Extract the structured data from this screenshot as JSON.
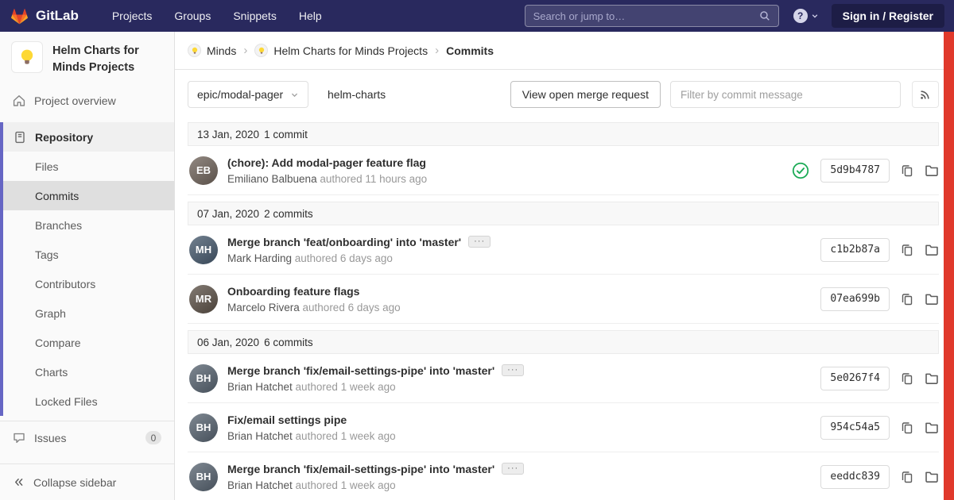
{
  "navbar": {
    "brand": "GitLab",
    "menu": [
      "Projects",
      "Groups",
      "Snippets",
      "Help"
    ],
    "search_placeholder": "Search or jump to…",
    "sign_in_label": "Sign in / Register"
  },
  "sidebar": {
    "project_title": "Helm Charts for Minds Projects",
    "overview_label": "Project overview",
    "repository_label": "Repository",
    "repo_items": [
      "Files",
      "Commits",
      "Branches",
      "Tags",
      "Contributors",
      "Graph",
      "Compare",
      "Charts",
      "Locked Files"
    ],
    "active_repo_item": "Commits",
    "issues_label": "Issues",
    "issues_count": "0",
    "collapse_label": "Collapse sidebar"
  },
  "breadcrumb": {
    "items": [
      {
        "label": "Minds",
        "avatar": true
      },
      {
        "label": "Helm Charts for Minds Projects",
        "avatar": true
      },
      {
        "label": "Commits",
        "avatar": false
      }
    ],
    "separator": "›"
  },
  "controls": {
    "branch": "epic/modal-pager",
    "repo_name": "helm-charts",
    "view_mr_label": "View open merge request",
    "filter_placeholder": "Filter by commit message"
  },
  "icons": {
    "ellipsis": "···"
  },
  "colors": {
    "navbar": "#29295e",
    "sidebar_accent": "#6666c4",
    "success_green": "#1aaa55",
    "scrollbar_red": "#e0392b",
    "logo_red": "#e24329",
    "logo_orange": "#fc6d26",
    "logo_yellow": "#fca326"
  },
  "commits": {
    "groups": [
      {
        "date": "13 Jan, 2020",
        "count": "1 commit",
        "items": [
          {
            "title": "(chore): Add modal-pager feature flag",
            "author": "Emiliano Balbuena",
            "time": "authored 11 hours ago",
            "sha": "5d9b4787",
            "pipeline_passed": true,
            "expandable": false,
            "initials": "EB",
            "avatar_color": "#6e6259"
          }
        ]
      },
      {
        "date": "07 Jan, 2020",
        "count": "2 commits",
        "items": [
          {
            "title": "Merge branch 'feat/onboarding' into 'master'",
            "author": "Mark Harding",
            "time": "authored 6 days ago",
            "sha": "c1b2b87a",
            "pipeline_passed": false,
            "expandable": true,
            "initials": "MH",
            "avatar_color": "#44576b"
          },
          {
            "title": "Onboarding feature flags",
            "author": "Marcelo Rivera",
            "time": "authored 6 days ago",
            "sha": "07ea699b",
            "pipeline_passed": false,
            "expandable": false,
            "initials": "MR",
            "avatar_color": "#5a4f45"
          }
        ]
      },
      {
        "date": "06 Jan, 2020",
        "count": "6 commits",
        "items": [
          {
            "title": "Merge branch 'fix/email-settings-pipe' into 'master'",
            "author": "Brian Hatchet",
            "time": "authored 1 week ago",
            "sha": "5e0267f4",
            "pipeline_passed": false,
            "expandable": true,
            "initials": "BH",
            "avatar_color": "#55616e"
          },
          {
            "title": "Fix/email settings pipe",
            "author": "Brian Hatchet",
            "time": "authored 1 week ago",
            "sha": "954c54a5",
            "pipeline_passed": false,
            "expandable": false,
            "initials": "BH",
            "avatar_color": "#55616e"
          },
          {
            "title": "Merge branch 'fix/email-settings-pipe' into 'master'",
            "author": "Brian Hatchet",
            "time": "authored 1 week ago",
            "sha": "eeddc839",
            "pipeline_passed": false,
            "expandable": true,
            "initials": "BH",
            "avatar_color": "#55616e"
          }
        ]
      }
    ]
  }
}
